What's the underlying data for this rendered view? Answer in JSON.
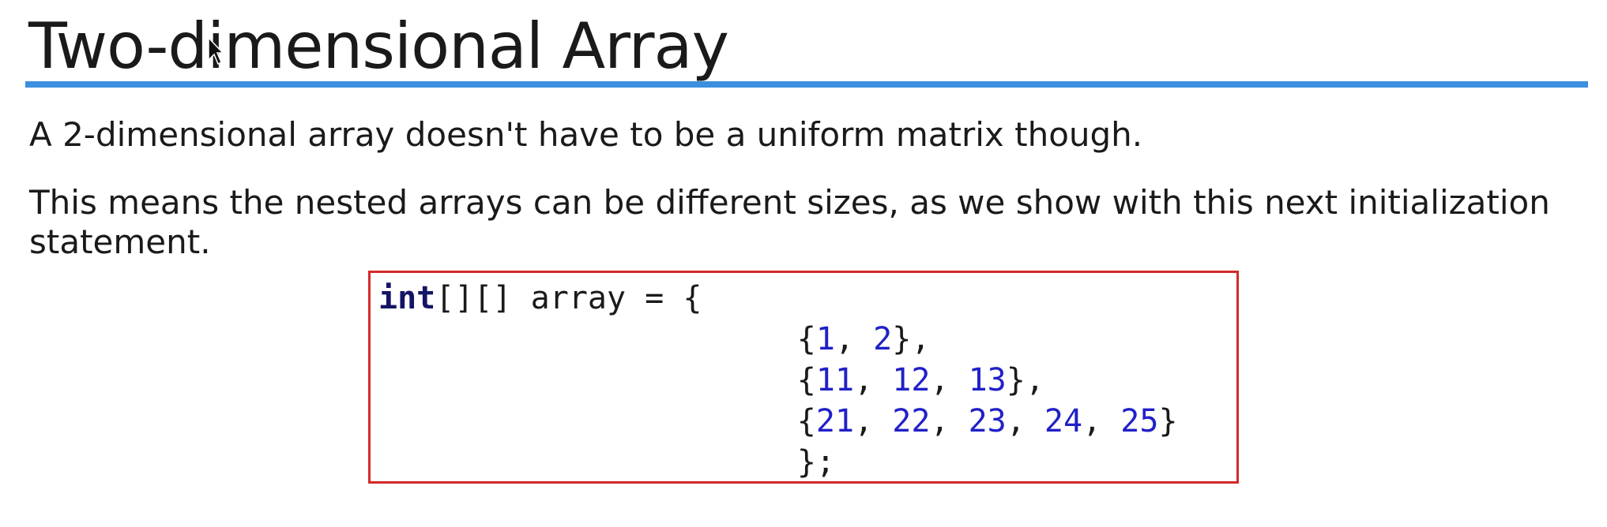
{
  "title": "Two-dimensional Array",
  "paragraphs": [
    "A 2-dimensional array doesn't have to be a uniform matrix though.",
    "This means the nested arrays can be different sizes, as we show with this next initialization statement."
  ],
  "code": {
    "declaration": {
      "keyword": "int",
      "rest": "[][] array = {"
    },
    "rows": [
      {
        "values": [
          "1",
          "2"
        ],
        "suffix": "},"
      },
      {
        "values": [
          "11",
          "12",
          "13"
        ],
        "suffix": "},"
      },
      {
        "values": [
          "21",
          "22",
          "23",
          "24",
          "25"
        ],
        "suffix": "}"
      }
    ],
    "closing": "};"
  },
  "colors": {
    "title_rule": "#3d8fe0",
    "code_border": "#d42a2a",
    "keyword": "#141466",
    "number": "#2020c8"
  },
  "icons": {
    "cursor": "mouse-pointer-icon"
  }
}
